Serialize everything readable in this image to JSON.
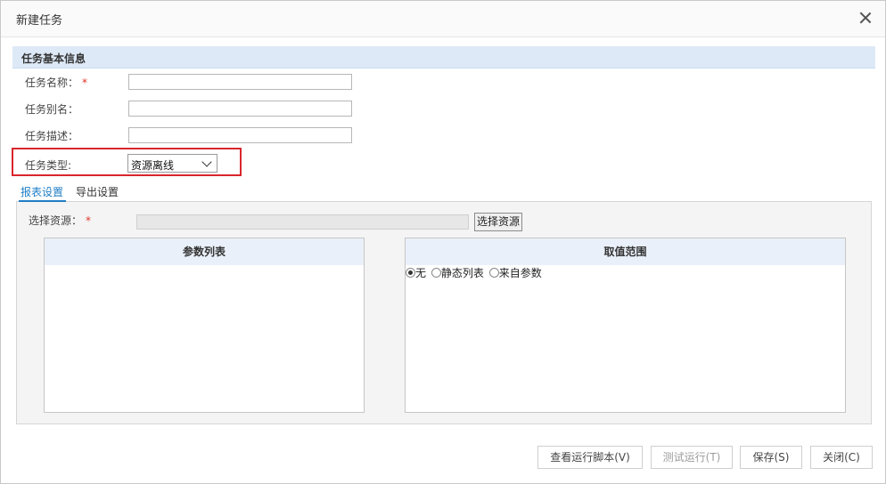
{
  "dialog": {
    "title": "新建任务"
  },
  "basic_info": {
    "header": "任务基本信息",
    "name_label": "任务名称：",
    "name_required": "*",
    "alias_label": "任务别名：",
    "desc_label": "任务描述：",
    "type_label": "任务类型:",
    "type_value": "资源离线"
  },
  "tabs": [
    "报表设置",
    "导出设置"
  ],
  "report_settings": {
    "resource_label": "选择资源：",
    "resource_required": "*",
    "select_resource_button": "选择资源",
    "param_list_header": "参数列表",
    "value_range_header": "取值范围",
    "radio_options": [
      "无",
      "静态列表",
      "来自参数"
    ],
    "radio_selected": "无"
  },
  "footer": {
    "view_script": "查看运行脚本(V)",
    "test_run": "测试运行(T)",
    "save": "保存(S)",
    "close": "关闭(C)"
  }
}
